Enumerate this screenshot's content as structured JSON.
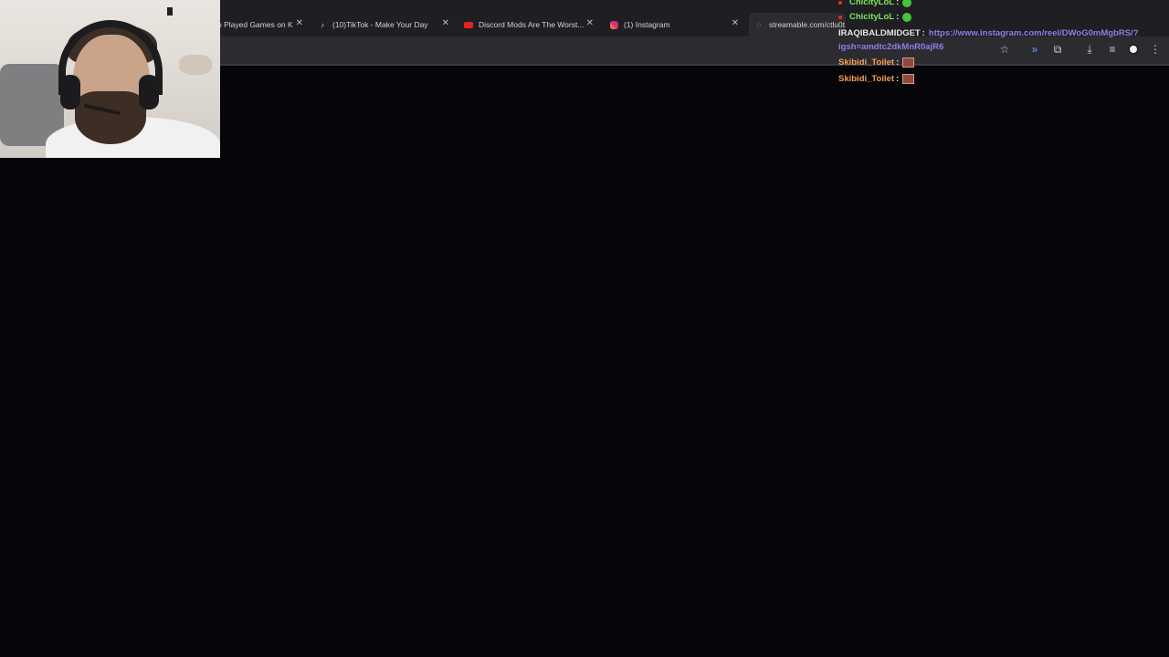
{
  "browser": {
    "tabs": [
      {
        "title": "p Played Games on K",
        "favicon": ""
      },
      {
        "title": "(10)TikTok - Make Your Day",
        "favicon": "tiktok-icon"
      },
      {
        "title": "Discord Mods Are The Worst...",
        "favicon": "youtube-icon"
      },
      {
        "title": "(1) Instagram",
        "favicon": "instagram-icon"
      },
      {
        "title": "streamable.com/ctlu0t",
        "favicon": "globe-icon"
      }
    ],
    "close_glyph": "✕",
    "toolbar_icons": [
      "star-icon",
      "audio-icon",
      "extensions-icon",
      "download-icon",
      "media-icon",
      "profile-icon",
      "menu-icon"
    ]
  },
  "chat": {
    "messages": [
      {
        "user": "ChicityLoL",
        "text": "",
        "emote": "green-emote",
        "user_color": "green"
      },
      {
        "user": "ChicityLoL",
        "text": "",
        "emote": "green-emote",
        "user_color": "green"
      },
      {
        "user": "IRAQIBALDMIDGET",
        "text": "https://www.instagram.com/reel/DWoG0mMgbRS/?",
        "text2": "igsh=amdtc2dkMnR0ajR6",
        "emote": "",
        "user_color": "white"
      },
      {
        "user": "Skibidi_Toilet",
        "text": "",
        "emote": "toilet-emote",
        "user_color": "orange"
      },
      {
        "user": "Skibidi_Toilet",
        "text": "",
        "emote": "toilet-emote",
        "user_color": "orange"
      }
    ],
    "separator": ":"
  },
  "colors": {
    "background": "#05050a",
    "chat_green": "#7be75a",
    "chat_orange": "#f29f54",
    "link": "#8f7fe6"
  }
}
